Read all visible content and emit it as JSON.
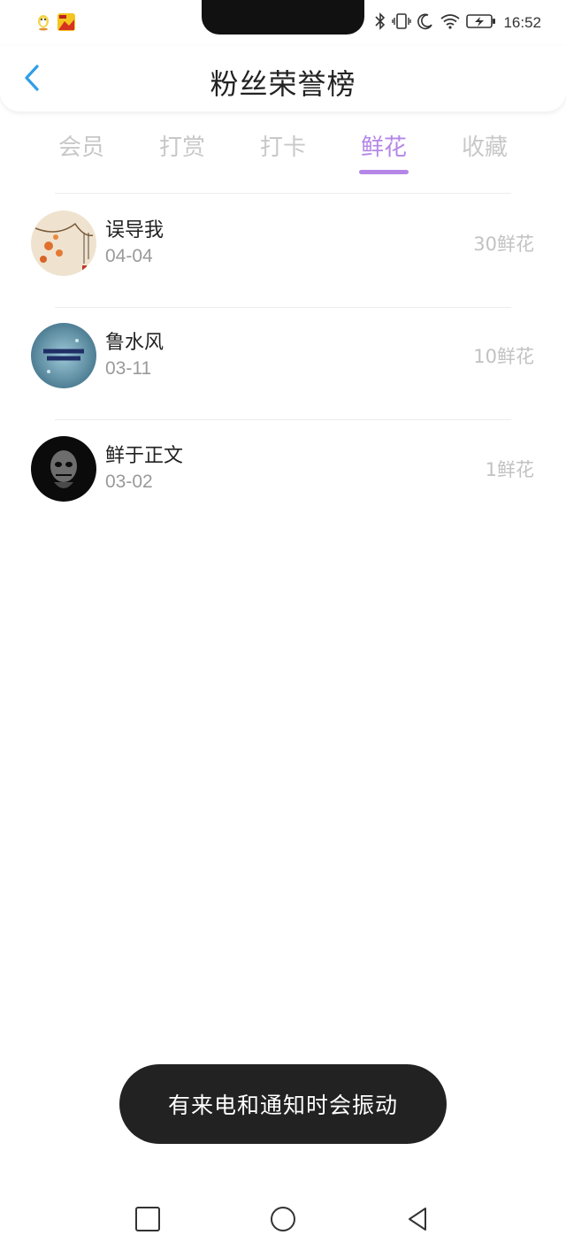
{
  "status_bar": {
    "time": "16:52",
    "left_icons": [
      "qq-penguin-app-icon",
      "video-app-icon"
    ],
    "right_icons": [
      "bluetooth-icon",
      "vibrate-icon",
      "moon-icon",
      "wifi-icon",
      "battery-charging-icon"
    ]
  },
  "header": {
    "title": "粉丝荣誉榜",
    "back_icon": "chevron-left-icon",
    "accent_color": "#2f9ee8"
  },
  "tabs": [
    {
      "label": "会员",
      "active": false
    },
    {
      "label": "打赏",
      "active": false
    },
    {
      "label": "打卡",
      "active": false
    },
    {
      "label": "鲜花",
      "active": true
    },
    {
      "label": "收藏",
      "active": false
    }
  ],
  "active_tab_color": "#b487e6",
  "fans": [
    {
      "name": "误导我",
      "date": "04-04",
      "amount": "30鲜花",
      "avatar": "floral-painting-avatar"
    },
    {
      "name": "鲁水风",
      "date": "03-11",
      "amount": "10鲜花",
      "avatar": "blue-text-avatar"
    },
    {
      "name": "鲜于正文",
      "date": "03-02",
      "amount": "1鲜花",
      "avatar": "dark-skull-avatar"
    }
  ],
  "toast": {
    "text": "有来电和通知时会振动"
  },
  "nav_bar": {
    "buttons": [
      "recent-apps-square-icon",
      "home-circle-icon",
      "back-triangle-icon"
    ]
  }
}
